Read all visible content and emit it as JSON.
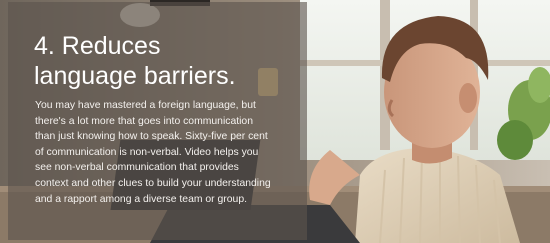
{
  "slide": {
    "headline_lines": [
      "4. Reduces",
      "language barriers."
    ],
    "body_lines": [
      "You may have mastered a foreign language, but",
      "there's a lot more that goes into communication",
      "than just knowing how to speak. Sixty-five per cent",
      "of communication is non-verbal. Video helps you",
      "see non-verbal communication that provides",
      "context and other clues to build your understanding",
      "and a rapport among a diverse team or group."
    ],
    "photo_icon": "man-at-laptop-photo",
    "overlay_color": "#5c544e"
  }
}
